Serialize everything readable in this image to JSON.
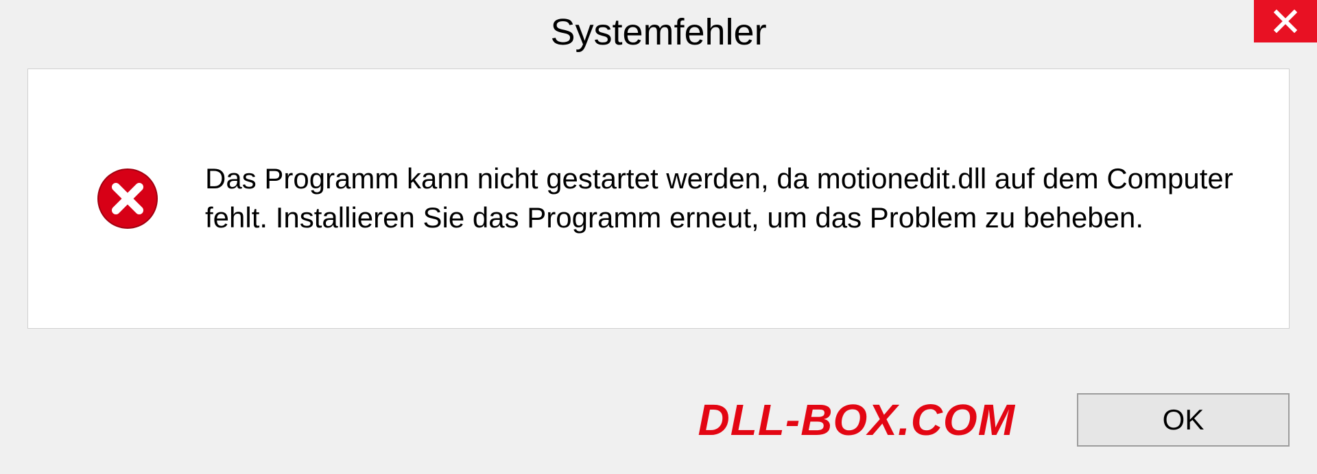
{
  "title": "Systemfehler",
  "message": "Das Programm kann nicht gestartet werden, da motionedit.dll auf dem Computer fehlt. Installieren Sie das Programm erneut, um das Problem zu beheben.",
  "ok_label": "OK",
  "watermark": "DLL-BOX.COM",
  "colors": {
    "close_bg": "#e81123",
    "error_icon": "#d70016",
    "watermark": "#e30613"
  }
}
